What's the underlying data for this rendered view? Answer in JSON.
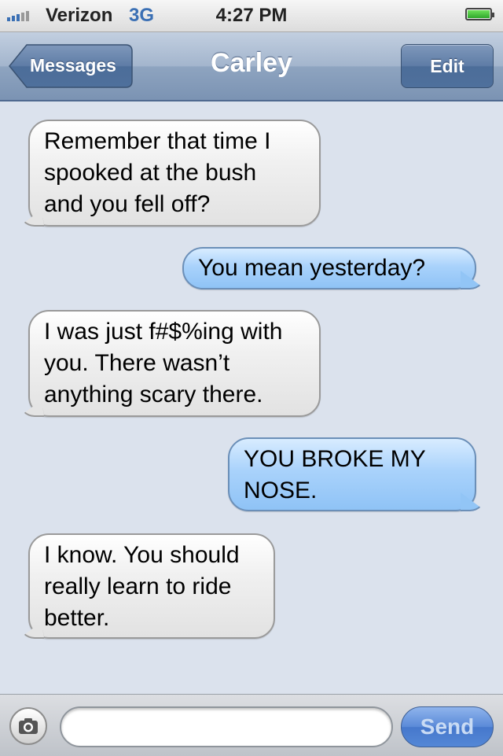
{
  "status_bar": {
    "carrier": "Verizon",
    "network": "3G",
    "time": "4:27 PM",
    "battery_level": 1.0,
    "signal_bars": 3
  },
  "nav": {
    "back_label": "Messages",
    "title": "Carley",
    "edit_label": "Edit"
  },
  "messages": [
    {
      "sender": "contact",
      "lines": [
        "Remember that time I",
        "spooked at the bush",
        "and you fell off?"
      ]
    },
    {
      "sender": "me",
      "lines": [
        "You mean yesterday?"
      ]
    },
    {
      "sender": "contact",
      "lines": [
        "I was just f#$%ing with",
        "you. There wasn’t",
        "anything scary there."
      ]
    },
    {
      "sender": "me",
      "lines": [
        "YOU BROKE MY",
        "NOSE."
      ]
    },
    {
      "sender": "contact",
      "lines": [
        "I know. You should",
        "really learn to ride",
        "better."
      ]
    }
  ],
  "input_bar": {
    "text_value": "",
    "send_label": "Send",
    "camera_icon": "camera-icon"
  },
  "colors": {
    "background": "#dbe2ed",
    "incoming_bubble": "#e6e6e6",
    "outgoing_bubble": "#a9d2fb",
    "nav_bar": "#8ea4c0"
  }
}
